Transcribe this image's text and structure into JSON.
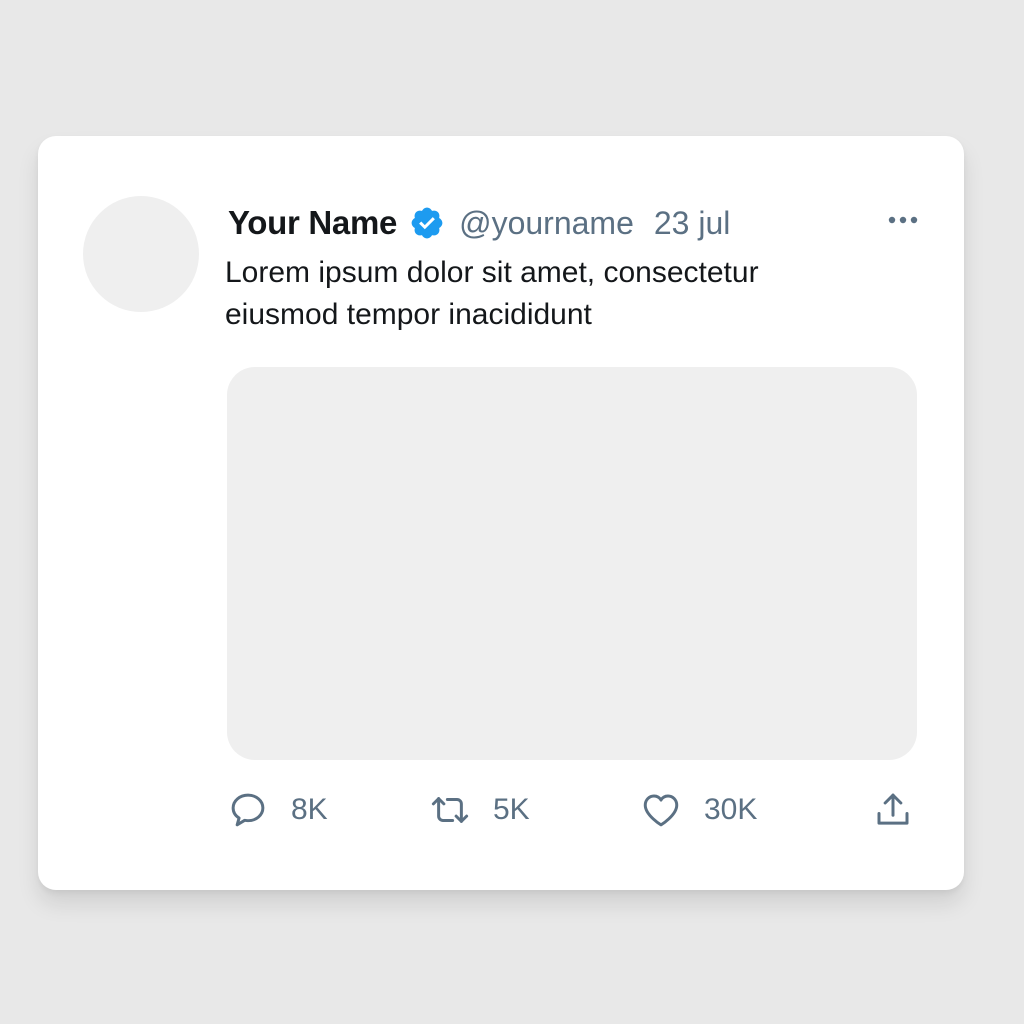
{
  "tweet": {
    "name": "Your Name",
    "handle": "@yourname",
    "date": "23 jul",
    "text_lines": [
      "Lorem ipsum dolor sit amet, consectetur",
      "eiusmod tempor inacididunt"
    ],
    "verified_badge_color": "#1d9bf0"
  },
  "actions": {
    "reply": {
      "icon": "reply-icon",
      "count": "8K"
    },
    "retweet": {
      "icon": "retweet-icon",
      "count": "5K"
    },
    "like": {
      "icon": "heart-icon",
      "count": "30K"
    },
    "share": {
      "icon": "share-icon"
    }
  },
  "colors": {
    "background": "#e8e8e8",
    "card": "#ffffff",
    "placeholder": "#efefef",
    "primary_text": "#14171a",
    "secondary_text": "#5b7083"
  }
}
